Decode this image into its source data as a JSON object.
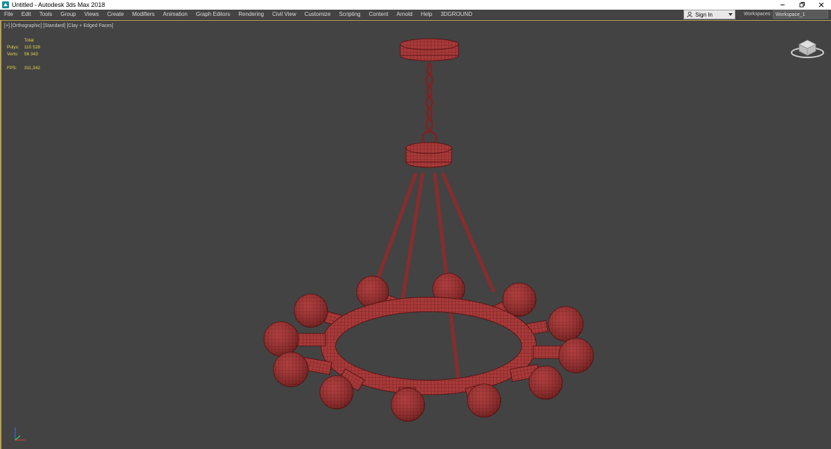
{
  "window": {
    "title": "Untitled - Autodesk 3ds Max 2018",
    "app_icon": "3dsmax-icon",
    "minimize": "–",
    "restore": "❐",
    "close": "✕"
  },
  "menu": {
    "items": [
      "File",
      "Edit",
      "Tools",
      "Group",
      "Views",
      "Create",
      "Modifiers",
      "Animation",
      "Graph Editors",
      "Rendering",
      "Civil View",
      "Customize",
      "Scripting",
      "Content",
      "Arnold",
      "Help",
      "3DGROUND"
    ],
    "sign_in": "Sign In",
    "workspaces_label": "Workspaces:",
    "workspace_value": "Workspace_1"
  },
  "viewport": {
    "label": "[+] [Orthographic] [Standard] [Clay + Edged Faces]",
    "stats": {
      "header": "Total",
      "polys_label": "Polys:",
      "polys_value": "110 528",
      "verts_label": "Verts:",
      "verts_value": "56 343",
      "fps_label": "FPS:",
      "fps_value": "311,342"
    }
  },
  "colors": {
    "accent": "#b9a14e",
    "stats_text": "#e6d94a",
    "model_fill": "#a83a3a",
    "model_wire": "#5a1414",
    "viewport_bg": "#434343"
  }
}
